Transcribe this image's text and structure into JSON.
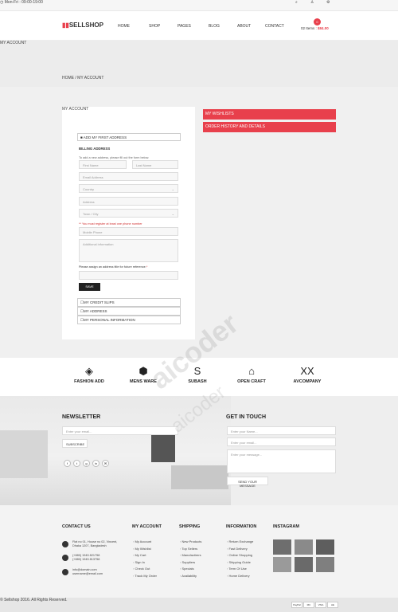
{
  "topbar": {
    "hours": "Mon-Fri : 09:00-19:00",
    "icons": [
      "search-icon",
      "user-icon",
      "settings-icon"
    ]
  },
  "header": {
    "logo": "SELLSHOP",
    "nav": [
      "HOME",
      "SHOP",
      "PAGES",
      "BLOG",
      "ABOUT",
      "CONTACT"
    ],
    "cart_count": "0",
    "cart_items": "02 Items :",
    "cart_total": "$84.00"
  },
  "banner": {
    "title": "MY ACCOUNT",
    "breadcrumb_home": "HOME",
    "breadcrumb_sep": "/",
    "breadcrumb_current": "MY ACCOUNT"
  },
  "account": {
    "heading": "MY ACCOUNT",
    "first_address": "■ ADD MY FIRST ADDRESS",
    "billing": "BILLING ADDRESS",
    "intro": "To add a new address, please fill out the form below.",
    "first_name": "First Name",
    "last_name": "Last Name",
    "email": "Email Address",
    "country": "Country",
    "address": "Address",
    "town": "Town / City",
    "phone_note": "** You must register at least one phone number",
    "mobile": "Mobile Phone",
    "additional": "Additional information",
    "assign": "Please assign an address title for future reference.",
    "save": "SAVE",
    "credit": "MY CREDIT SLIPS",
    "my_address": "MY ADDRESS",
    "personal": "MY PERSONAL INFORMATION"
  },
  "side": {
    "wishlists": "MY WISHLISTS",
    "orders": "ORDER HISTORY AND DETAILS"
  },
  "brands": [
    {
      "name": "FASHION ADD",
      "glyph": "◈"
    },
    {
      "name": "MENS WARE",
      "glyph": "⬢"
    },
    {
      "name": "SUBASH",
      "glyph": "S"
    },
    {
      "name": "OPEN CRAFT",
      "glyph": "⌂"
    },
    {
      "name": "AVCOMPANY",
      "glyph": "XX"
    }
  ],
  "newsletter": {
    "title": "NEWSLETTER",
    "placeholder": "Enter your email...",
    "button": "SUBSCRIBE",
    "social": [
      "f",
      "t",
      "g",
      "in",
      "✉"
    ]
  },
  "touch": {
    "title": "GET IN TOUCH",
    "name": "Enter your Name...",
    "email": "Enter your email...",
    "message": "Enter your message...",
    "button": "SEND YOUR MESSAGE"
  },
  "footer": {
    "contact": {
      "title": "CONTACT US",
      "address1": "Flat no 01, House no 02, Vincent,",
      "address2": "Dhaka 1207, Bangladesh",
      "phone1": "(+880) 1945 821758",
      "phone2": "(+880) 1945 813758",
      "mail1": "info@domain.com",
      "mail2": "username@email.com"
    },
    "myaccount": {
      "title": "MY ACCOUNT",
      "links": [
        "My Account",
        "My Wishlist",
        "My Cart",
        "Sign In",
        "Check Out",
        "Track My Order"
      ]
    },
    "shipping": {
      "title": "SHIPPING",
      "links": [
        "New Products",
        "Top Sellers",
        "Manufactirers",
        "Suppliers",
        "Specials",
        "Availability"
      ]
    },
    "information": {
      "title": "INFORMATION",
      "links": [
        "Return Exchange",
        "Fast Delivery",
        "Online Shopping",
        "Shipping Guide",
        "Term Of Use",
        "Home Delivery"
      ]
    },
    "instagram": {
      "title": "INSTAGRAM"
    }
  },
  "bottom": {
    "copyright": "© Sellshop 2016. All Rights Reserved.",
    "payments": [
      "PayPal",
      "MC",
      "VISA",
      "AE"
    ]
  },
  "watermark": "aicoder"
}
